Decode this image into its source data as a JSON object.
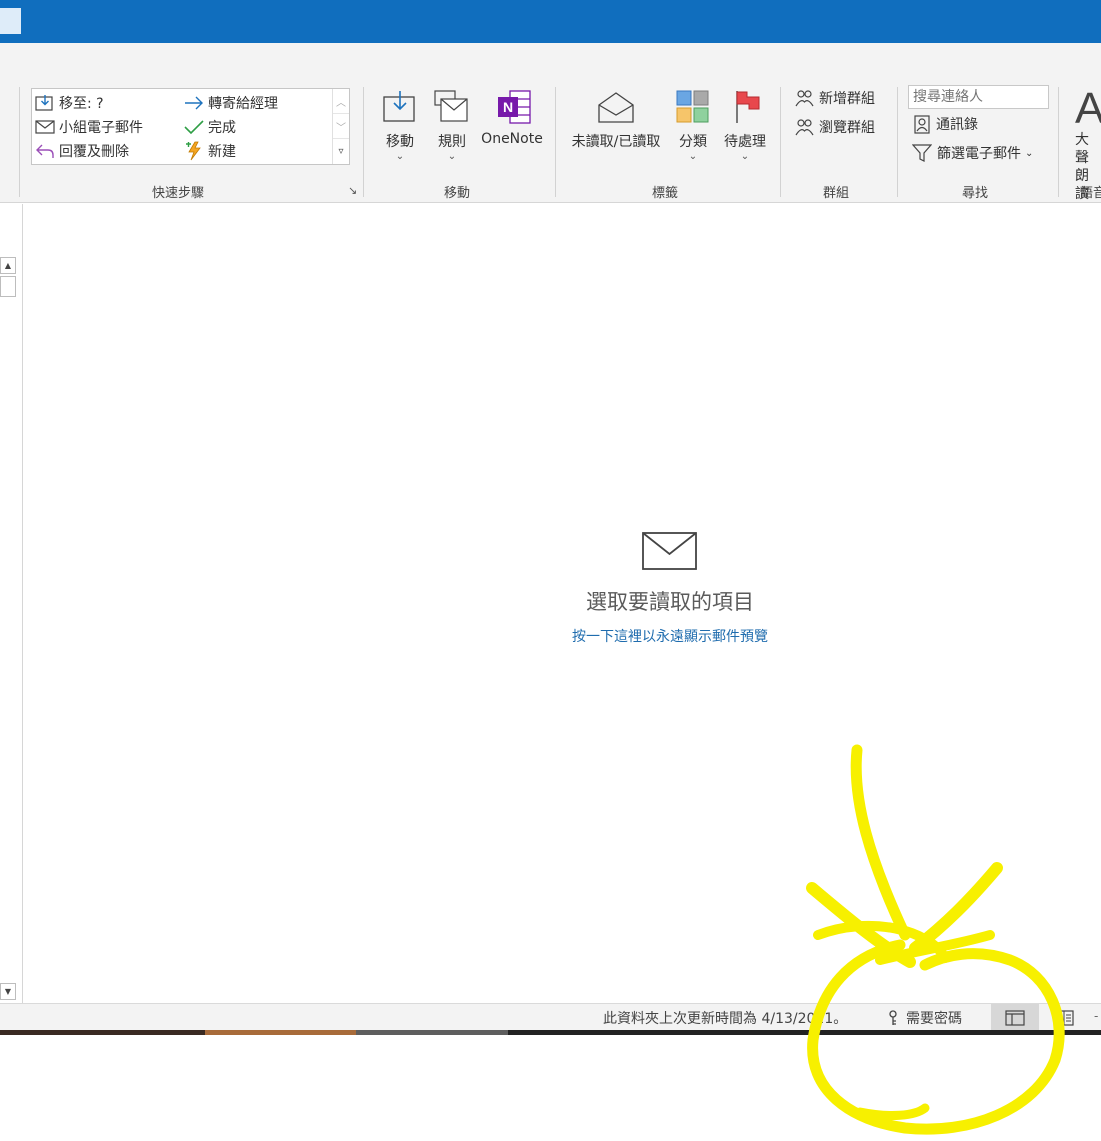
{
  "ribbon": {
    "quick_steps": {
      "items": [
        {
          "label": "移至: ?",
          "icon": "move-to-folder-icon"
        },
        {
          "label": "小組電子郵件",
          "icon": "envelope-icon"
        },
        {
          "label": "回覆及刪除",
          "icon": "reply-icon"
        },
        {
          "label": "轉寄給經理",
          "icon": "forward-arrow-icon"
        },
        {
          "label": "完成",
          "icon": "checkmark-icon"
        },
        {
          "label": "新建",
          "icon": "lightning-icon"
        }
      ],
      "group_label": "快速步驟"
    },
    "move_group": {
      "move_label": "移動",
      "rules_label": "規則",
      "onenote_label": "OneNote",
      "group_label": "移動"
    },
    "tags_group": {
      "unread_label": "未讀取/已讀取",
      "categorize_label": "分類",
      "followup_label": "待處理",
      "group_label": "標籤"
    },
    "groups_group": {
      "new_group_label": "新增群組",
      "browse_groups_label": "瀏覽群組",
      "group_label": "群組"
    },
    "find_group": {
      "search_placeholder": "搜尋連絡人",
      "address_book_label": "通訊錄",
      "filter_email_label": "篩選電子郵件",
      "group_label": "尋找"
    },
    "speech_group": {
      "read_aloud_label_1": "大聲",
      "read_aloud_label_2": "朗讀",
      "group_label": "語音"
    }
  },
  "reading_pane": {
    "empty_title": "選取要讀取的項目",
    "empty_link": "按一下這裡以永遠顯示郵件預覽"
  },
  "status_bar": {
    "folder_updated_text": "此資料夾上次更新時間為 4/13/2021。",
    "password_needed_text": "需要密碼"
  },
  "colors": {
    "titlebar": "#106ebe",
    "link": "#1f6cae",
    "onenote": "#7719aa",
    "flag": "#e8484d",
    "scribble": "#f7f000"
  }
}
